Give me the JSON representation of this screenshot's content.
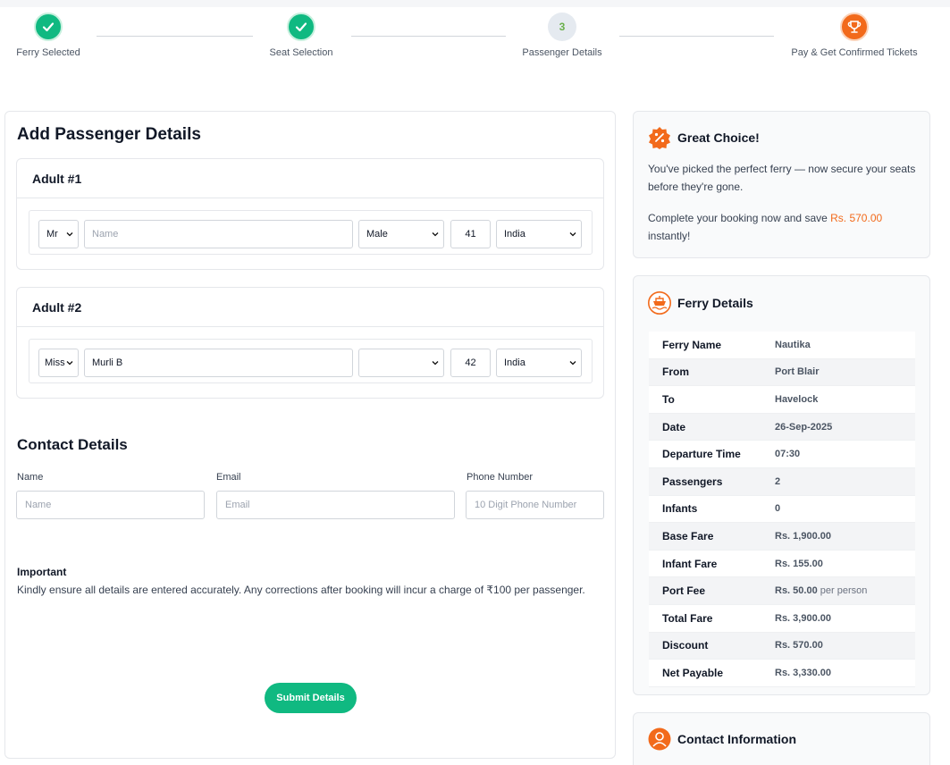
{
  "stepper": {
    "steps": [
      {
        "label": "Ferry Selected",
        "state": "done"
      },
      {
        "label": "Seat Selection",
        "state": "done"
      },
      {
        "label": "Passenger Details",
        "number": "3",
        "state": "current"
      },
      {
        "label": "Pay & Get Confirmed Tickets",
        "state": "upcoming",
        "icon": "trophy-icon"
      }
    ]
  },
  "form": {
    "title": "Add Passenger Details",
    "adults": [
      {
        "heading": "Adult #1",
        "title": "Mr",
        "name_value": "",
        "name_placeholder": "Name",
        "gender": "Male",
        "age": "41",
        "nationality": "India"
      },
      {
        "heading": "Adult #2",
        "title": "Miss",
        "name_value": "Murli B",
        "name_placeholder": "Name",
        "gender": "",
        "age": "42",
        "nationality": "India"
      }
    ],
    "contact": {
      "title": "Contact Details",
      "name_label": "Name",
      "name_placeholder": "Name",
      "email_label": "Email",
      "email_placeholder": "Email",
      "phone_label": "Phone Number",
      "phone_placeholder": "10 Digit Phone Number"
    },
    "important_title": "Important",
    "important_text": "Kindly ensure all details are entered accurately. Any corrections after booking will incur a charge of ₹100 per passenger.",
    "submit_label": "Submit Details"
  },
  "great_choice": {
    "title": "Great Choice!",
    "line1": "You've picked the perfect ferry — now secure your seats before they're gone.",
    "line2_prefix": "Complete your booking now and save ",
    "savings": "Rs. 570.00",
    "line2_suffix": " instantly!"
  },
  "ferry_details": {
    "title": "Ferry Details",
    "rows": [
      {
        "label": "Ferry Name",
        "value": "Nautika",
        "suffix": ""
      },
      {
        "label": "From",
        "value": "Port Blair",
        "suffix": ""
      },
      {
        "label": "To",
        "value": "Havelock",
        "suffix": ""
      },
      {
        "label": "Date",
        "value": "26-Sep-2025",
        "suffix": ""
      },
      {
        "label": "Departure Time",
        "value": "07:30",
        "suffix": ""
      },
      {
        "label": "Passengers",
        "value": "2",
        "suffix": ""
      },
      {
        "label": "Infants",
        "value": "0",
        "suffix": ""
      },
      {
        "label": "Base Fare",
        "value": "Rs. 1,900.00",
        "suffix": ""
      },
      {
        "label": "Infant Fare",
        "value": "Rs. 155.00",
        "suffix": ""
      },
      {
        "label": "Port Fee",
        "value": "Rs. 50.00",
        "suffix": " per person"
      },
      {
        "label": "Total Fare",
        "value": "Rs. 3,900.00",
        "suffix": ""
      },
      {
        "label": "Discount",
        "value": "Rs. 570.00",
        "suffix": ""
      },
      {
        "label": "Net Payable",
        "value": "Rs. 3,330.00",
        "suffix": ""
      }
    ]
  },
  "contact_info": {
    "title": "Contact Information"
  },
  "colors": {
    "accent_green": "#10b981",
    "accent_orange": "#f26a1b"
  }
}
